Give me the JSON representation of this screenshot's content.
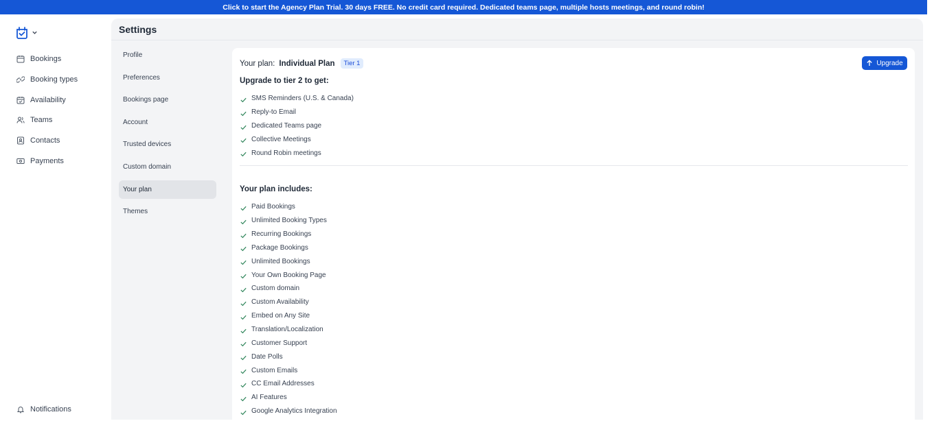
{
  "banner": {
    "text": "Click to start the Agency Plan Trial. 30 days FREE. No credit card required. Dedicated teams page, multiple hosts meetings, and round robin!"
  },
  "sidebar": {
    "items": [
      {
        "label": "Bookings",
        "icon": "calendar-icon"
      },
      {
        "label": "Booking types",
        "icon": "link-icon"
      },
      {
        "label": "Availability",
        "icon": "calendar-check-icon"
      },
      {
        "label": "Teams",
        "icon": "users-icon"
      },
      {
        "label": "Contacts",
        "icon": "contact-card-icon"
      },
      {
        "label": "Payments",
        "icon": "payments-icon"
      }
    ],
    "notifications": "Notifications"
  },
  "settings": {
    "title": "Settings",
    "subnav": [
      "Profile",
      "Preferences",
      "Bookings page",
      "Account",
      "Trusted devices",
      "Custom domain",
      "Your plan",
      "Themes"
    ],
    "active": "Your plan"
  },
  "plan": {
    "prefix": "Your plan:",
    "name": "Individual Plan",
    "tier": "Tier 1",
    "upgrade_label": "Upgrade",
    "upgrade_title": "Upgrade to tier 2 to get:",
    "upgrade_features": [
      "SMS Reminders (U.S. & Canada)",
      "Reply-to Email",
      "Dedicated Teams page",
      "Collective Meetings",
      "Round Robin meetings"
    ],
    "includes_title": "Your plan includes:",
    "includes_features": [
      "Paid Bookings",
      "Unlimited Booking Types",
      "Recurring Bookings",
      "Package Bookings",
      "Unlimited Bookings",
      "Your Own Booking Page",
      "Custom domain",
      "Custom Availability",
      "Embed on Any Site",
      "Translation/Localization",
      "Customer Support",
      "Date Polls",
      "Custom Emails",
      "CC Email Addresses",
      "AI Features",
      "Google Analytics Integration"
    ]
  },
  "colors": {
    "accent": "#1557d6",
    "check": "#2f855a",
    "tier_bg": "#e0ecfd"
  }
}
